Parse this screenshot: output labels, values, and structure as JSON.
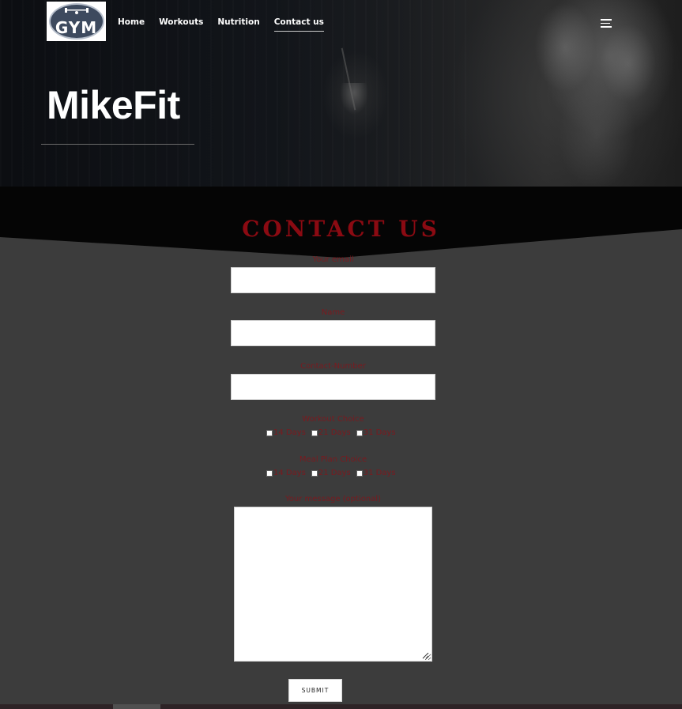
{
  "brand": {
    "logo_text": "GYM"
  },
  "nav": {
    "items": [
      {
        "label": "Home"
      },
      {
        "label": "Workouts"
      },
      {
        "label": "Nutrition"
      },
      {
        "label": "Contact us"
      }
    ],
    "active": "Contact us"
  },
  "hero": {
    "title": "MikeFit"
  },
  "contact": {
    "heading": "CONTACT US",
    "email_label": "Your email",
    "email_value": "",
    "name_label": "Name",
    "name_value": "",
    "phone_label": "Contact-Number",
    "phone_value": "",
    "workout_label": "Workout Choice",
    "workout_options": [
      "14 Days",
      "21 Days",
      "31 Days"
    ],
    "meal_label": "Meal Plan Choice",
    "meal_options": [
      "14 Days",
      "21 Days",
      "31 Days"
    ],
    "message_label": "Your message (optional)",
    "message_value": "",
    "submit_label": "SUBMIT"
  },
  "colors": {
    "accent_red": "#8b0a12",
    "label_red": "#7a1a1f",
    "page_bg": "#3c3c3c",
    "band_black": "#050505"
  }
}
